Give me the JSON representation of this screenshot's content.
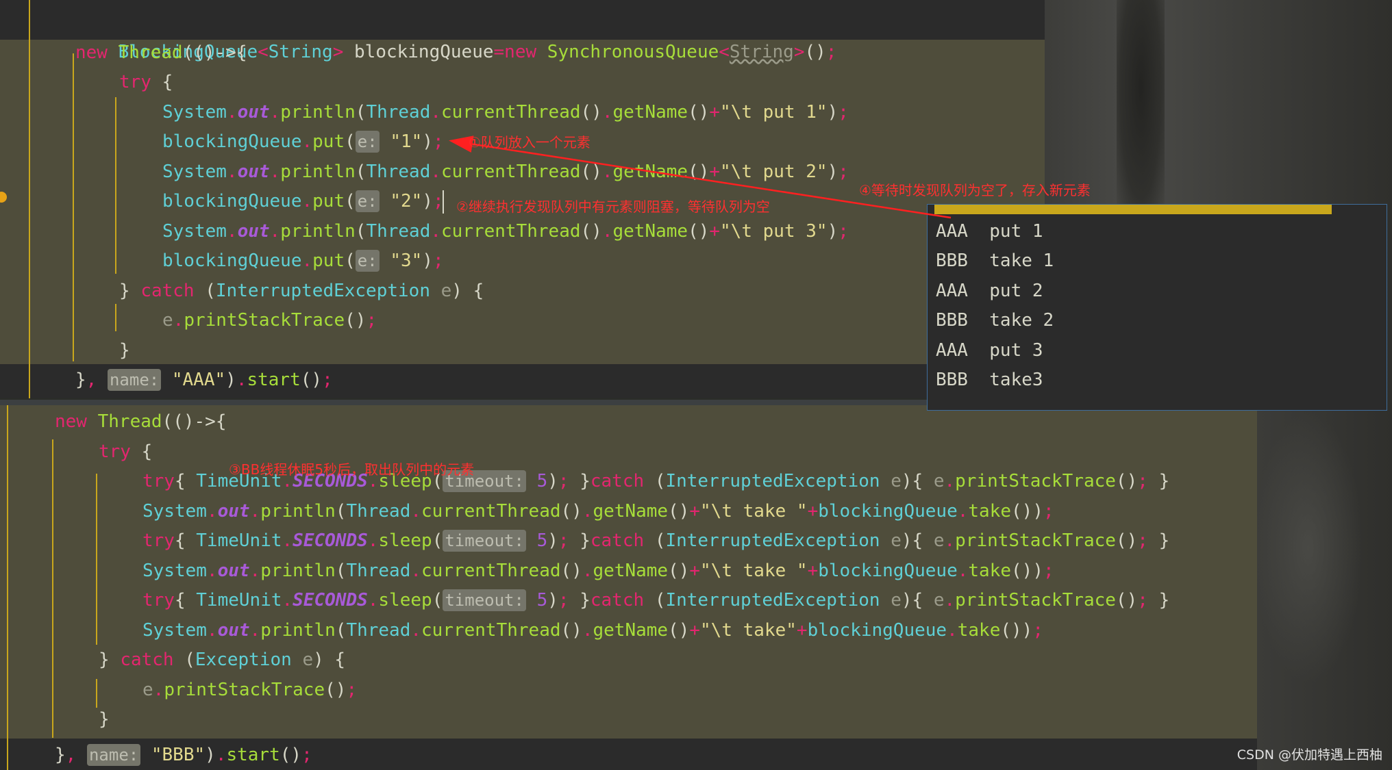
{
  "panel1": {
    "lines": [
      "BlockingQueue<String> blockingQueue=new SynchronousQueue<String>();",
      "new Thread(()->{",
      "try {",
      "System.out.println(Thread.currentThread().getName()+\"\\t put 1\");",
      "blockingQueue.put(e: \"1\");",
      "System.out.println(Thread.currentThread().getName()+\"\\t put 2\");",
      "blockingQueue.put(e: \"2\");",
      "System.out.println(Thread.currentThread().getName()+\"\\t put 3\");",
      "blockingQueue.put(e: \"3\");",
      "} catch (InterruptedException e) {",
      "e.printStackTrace();",
      "}",
      "}, name: \"AAA\").start();"
    ]
  },
  "panel2": {
    "lines": [
      "new Thread(()->{",
      "try {",
      "try{ TimeUnit.SECONDS.sleep(timeout: 5); }catch (InterruptedException e){ e.printStackTrace(); }",
      "System.out.println(Thread.currentThread().getName()+\"\\t take \"+blockingQueue.take());",
      "try{ TimeUnit.SECONDS.sleep(timeout: 5); }catch (InterruptedException e){ e.printStackTrace(); }",
      "System.out.println(Thread.currentThread().getName()+\"\\t take \"+blockingQueue.take());",
      "try{ TimeUnit.SECONDS.sleep(timeout: 5); }catch (InterruptedException e){ e.printStackTrace(); }",
      "System.out.println(Thread.currentThread().getName()+\"\\t take\"+blockingQueue.take());",
      "} catch (Exception e) {",
      "e.printStackTrace();",
      "}",
      "}, name: \"BBB\").start();"
    ]
  },
  "annotations": {
    "a1": "①队列放入一个元素",
    "a2": "②继续执行发现队列中有元素则阻塞，等待队列为空",
    "a3": "③BB线程休眠5秒后，取出队列中的元素",
    "a4": "④等待时发现队列为空了，存入新元素"
  },
  "console": {
    "lines": [
      "AAA  put 1",
      "BBB  take 1",
      "AAA  put 2",
      "BBB  take 2",
      "AAA  put 3",
      "BBB  take3"
    ]
  },
  "watermark": "CSDN @伏加特遇上西柚",
  "hints": {
    "e": "e:",
    "name": "name:",
    "timeout": "timeout:"
  },
  "colors": {
    "keyword": "#e3266f",
    "type": "#5fd0d6",
    "method": "#a7dd3a",
    "string": "#e2d98e",
    "field": "#a85ad8",
    "annotation": "#ff3030"
  }
}
